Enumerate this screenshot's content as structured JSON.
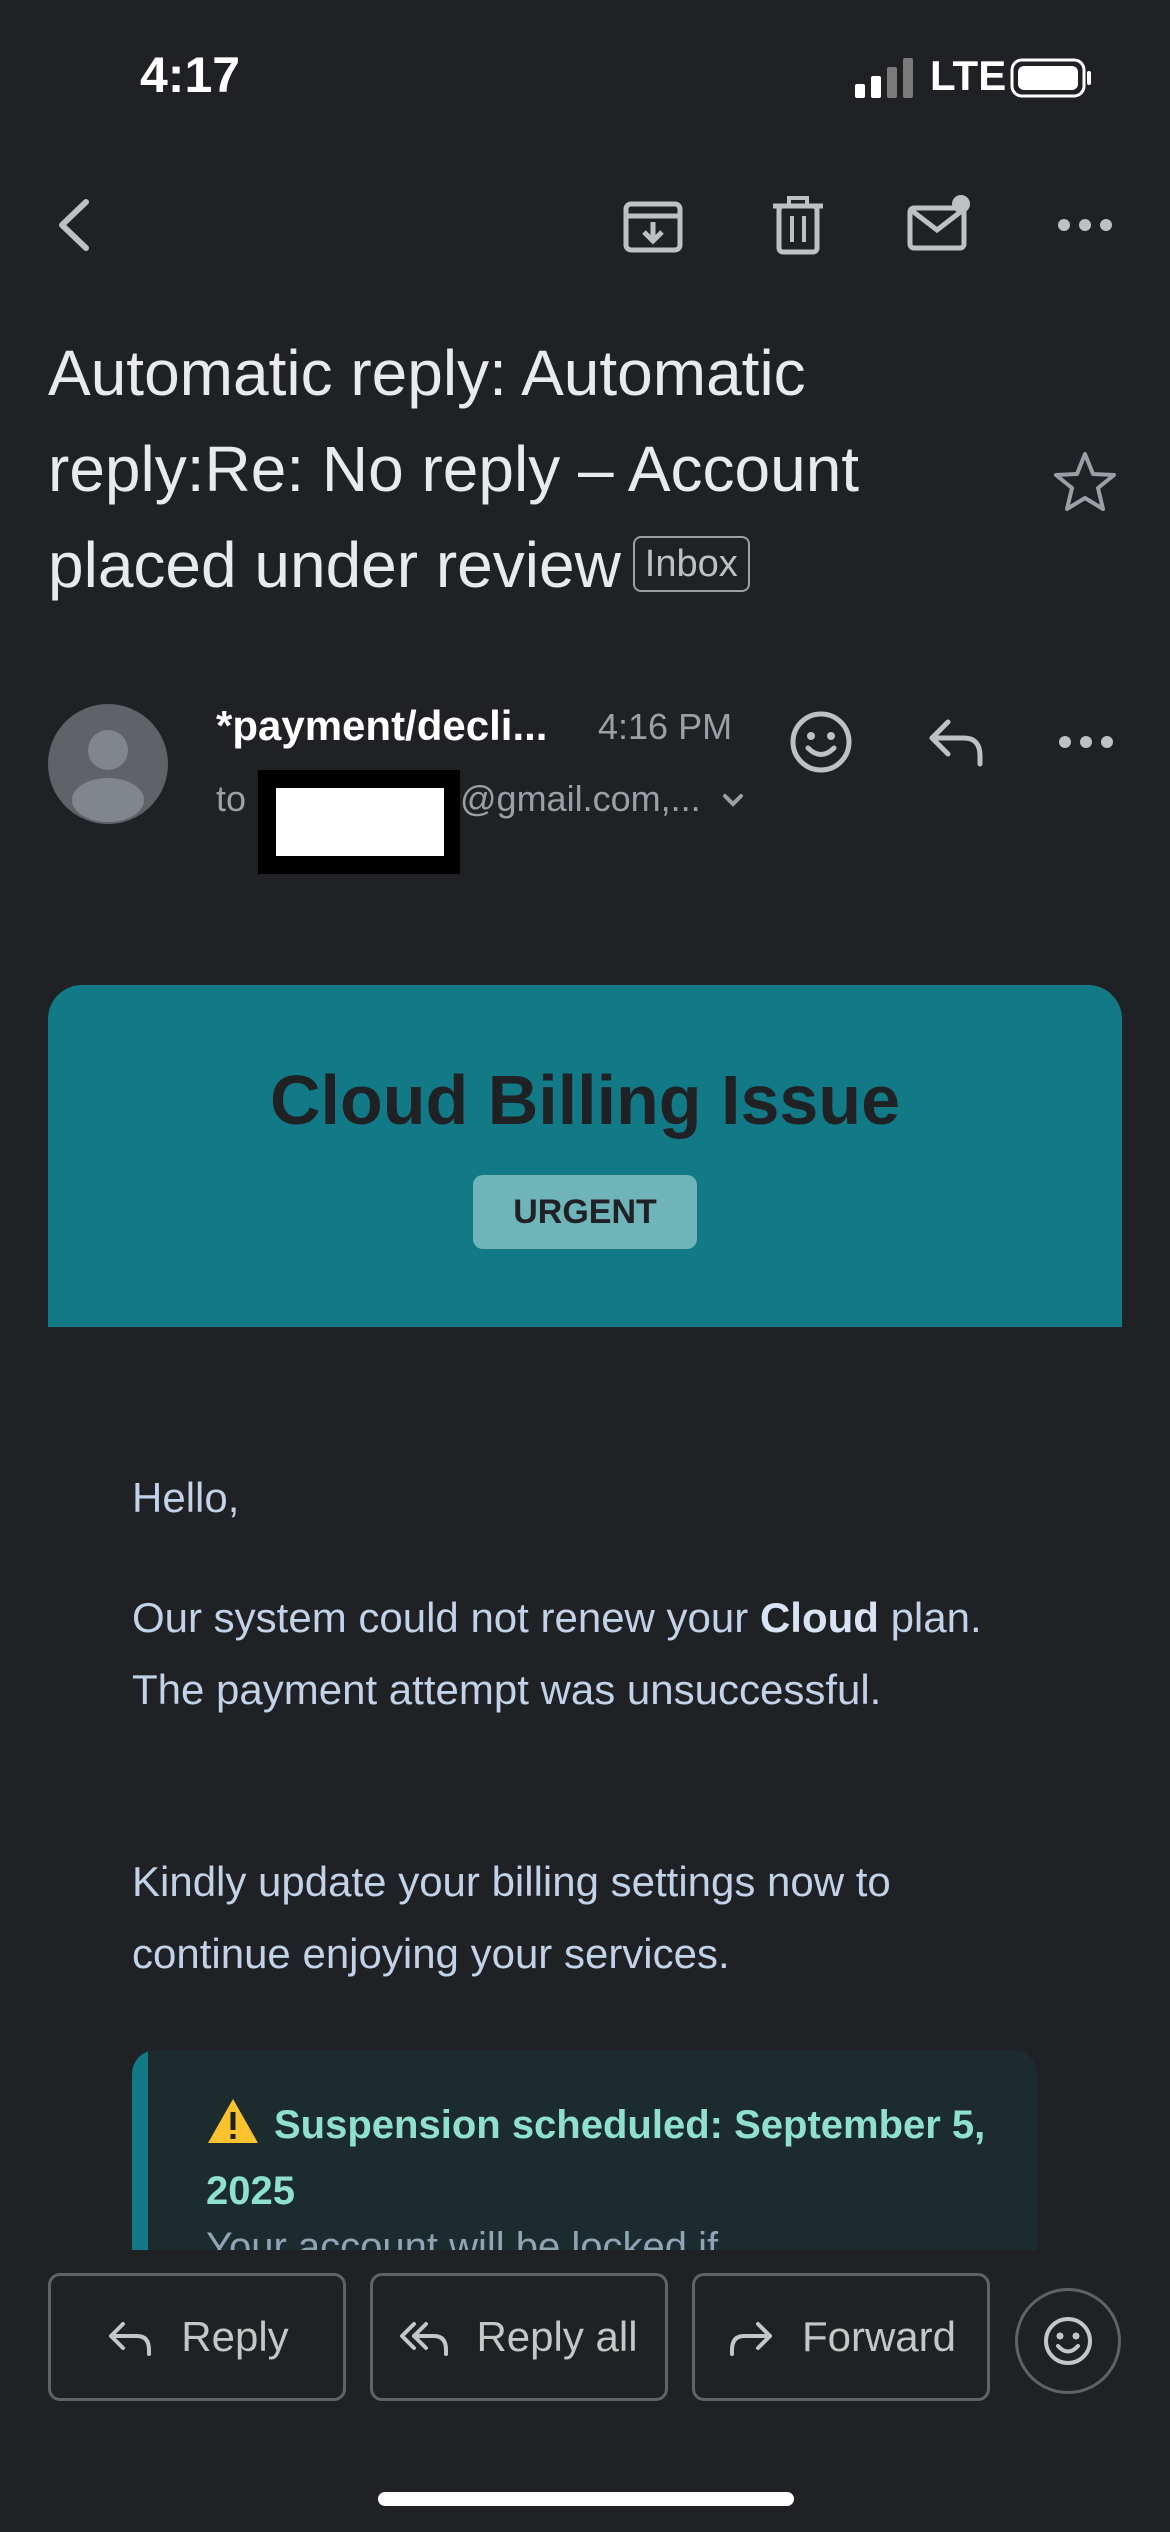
{
  "status_bar": {
    "time": "4:17",
    "network": "LTE"
  },
  "email": {
    "subject": "Automatic reply: Automatic reply:Re: No reply – Account placed under review",
    "label": "Inbox",
    "sender": "*payment/decli...",
    "time": "4:16 PM",
    "to_prefix": "to",
    "recipient_suffix": "@gmail.com,..."
  },
  "body": {
    "banner_title": "Cloud Billing Issue",
    "badge": "URGENT",
    "greeting": "Hello,",
    "para1_pre": "Our system could not renew your ",
    "para1_bold": "Cloud",
    "para1_post": " plan. The payment attempt was unsuccessful.",
    "para2": "Kindly update your billing settings now to continue enjoying your services.",
    "alert": "Suspension scheduled: September 5, 2025",
    "alert_clipped": "Your account will be locked if..."
  },
  "actions": {
    "reply": "Reply",
    "reply_all": "Reply all",
    "forward": "Forward"
  },
  "colors": {
    "background": "#202124",
    "banner": "#127a86",
    "alert_text": "#8fe0cc"
  }
}
